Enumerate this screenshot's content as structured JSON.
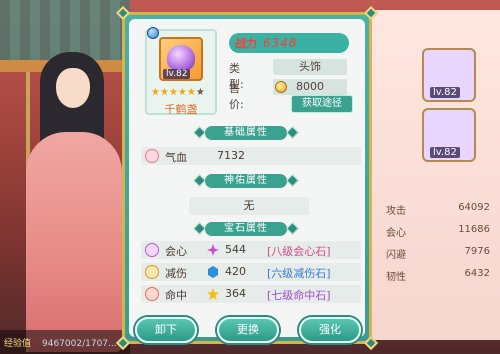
{
  "item": {
    "level": "lv.82",
    "name": "千鹤盏",
    "stars_on": 5,
    "stars_total": 6,
    "power_label": "战力",
    "power_value": "6348",
    "type_label": "类型:",
    "type_value": "头饰",
    "price_label": "售价:",
    "price_value": "8000",
    "source_button": "获取途径"
  },
  "sections": {
    "base": "基础属性",
    "blessing": "神佑属性",
    "gem": "宝石属性"
  },
  "base_attrs": [
    {
      "label": "气血",
      "value": "7132",
      "icon": "heart-icon"
    }
  ],
  "blessing_value": "无",
  "gem_attrs": [
    {
      "label": "会心",
      "value": "544",
      "link": "[八级会心石]",
      "icon": "crit-icon",
      "stone_color": "#c64ad6",
      "link_color": "#d14a8c"
    },
    {
      "label": "减伤",
      "value": "420",
      "link": "[六级减伤石]",
      "icon": "shield-icon",
      "stone_color": "#2f8fd6",
      "link_color": "#3a7bd1"
    },
    {
      "label": "命中",
      "value": "364",
      "link": "[七级命中石]",
      "icon": "target-icon",
      "stone_color": "#f2c21a",
      "link_color": "#a14ad1"
    }
  ],
  "buttons": {
    "unequip": "卸下",
    "replace": "更换",
    "enhance": "强化"
  },
  "right_panel": {
    "slots": [
      {
        "level": "lv.82"
      },
      {
        "level": "lv.82"
      }
    ],
    "rows": [
      {
        "label": "攻击",
        "value": "64092"
      },
      {
        "label": "会心",
        "value": "11686"
      },
      {
        "label": "闪避",
        "value": "7976"
      },
      {
        "label": "韧性",
        "value": "6432"
      }
    ]
  },
  "bottom_bar": {
    "label": "经验值",
    "value": "9467002/1707..."
  },
  "colors": {
    "panel_teal": "#3aa28e",
    "gold_border": "#d8b24d",
    "power_red": "#ff3a3a",
    "name_orange": "#e06a2a"
  }
}
